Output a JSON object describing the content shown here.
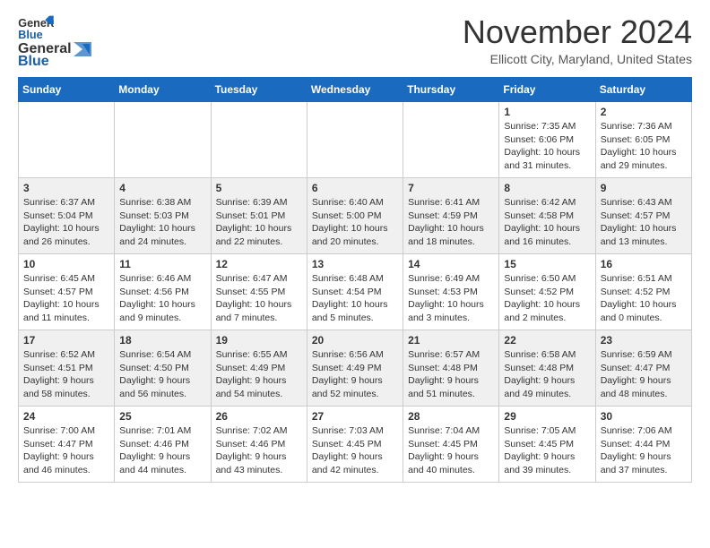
{
  "logo": {
    "general": "General",
    "blue": "Blue"
  },
  "title": "November 2024",
  "location": "Ellicott City, Maryland, United States",
  "days_of_week": [
    "Sunday",
    "Monday",
    "Tuesday",
    "Wednesday",
    "Thursday",
    "Friday",
    "Saturday"
  ],
  "weeks": [
    [
      {
        "day": "",
        "info": ""
      },
      {
        "day": "",
        "info": ""
      },
      {
        "day": "",
        "info": ""
      },
      {
        "day": "",
        "info": ""
      },
      {
        "day": "",
        "info": ""
      },
      {
        "day": "1",
        "info": "Sunrise: 7:35 AM\nSunset: 6:06 PM\nDaylight: 10 hours and 31 minutes."
      },
      {
        "day": "2",
        "info": "Sunrise: 7:36 AM\nSunset: 6:05 PM\nDaylight: 10 hours and 29 minutes."
      }
    ],
    [
      {
        "day": "3",
        "info": "Sunrise: 6:37 AM\nSunset: 5:04 PM\nDaylight: 10 hours and 26 minutes."
      },
      {
        "day": "4",
        "info": "Sunrise: 6:38 AM\nSunset: 5:03 PM\nDaylight: 10 hours and 24 minutes."
      },
      {
        "day": "5",
        "info": "Sunrise: 6:39 AM\nSunset: 5:01 PM\nDaylight: 10 hours and 22 minutes."
      },
      {
        "day": "6",
        "info": "Sunrise: 6:40 AM\nSunset: 5:00 PM\nDaylight: 10 hours and 20 minutes."
      },
      {
        "day": "7",
        "info": "Sunrise: 6:41 AM\nSunset: 4:59 PM\nDaylight: 10 hours and 18 minutes."
      },
      {
        "day": "8",
        "info": "Sunrise: 6:42 AM\nSunset: 4:58 PM\nDaylight: 10 hours and 16 minutes."
      },
      {
        "day": "9",
        "info": "Sunrise: 6:43 AM\nSunset: 4:57 PM\nDaylight: 10 hours and 13 minutes."
      }
    ],
    [
      {
        "day": "10",
        "info": "Sunrise: 6:45 AM\nSunset: 4:57 PM\nDaylight: 10 hours and 11 minutes."
      },
      {
        "day": "11",
        "info": "Sunrise: 6:46 AM\nSunset: 4:56 PM\nDaylight: 10 hours and 9 minutes."
      },
      {
        "day": "12",
        "info": "Sunrise: 6:47 AM\nSunset: 4:55 PM\nDaylight: 10 hours and 7 minutes."
      },
      {
        "day": "13",
        "info": "Sunrise: 6:48 AM\nSunset: 4:54 PM\nDaylight: 10 hours and 5 minutes."
      },
      {
        "day": "14",
        "info": "Sunrise: 6:49 AM\nSunset: 4:53 PM\nDaylight: 10 hours and 3 minutes."
      },
      {
        "day": "15",
        "info": "Sunrise: 6:50 AM\nSunset: 4:52 PM\nDaylight: 10 hours and 2 minutes."
      },
      {
        "day": "16",
        "info": "Sunrise: 6:51 AM\nSunset: 4:52 PM\nDaylight: 10 hours and 0 minutes."
      }
    ],
    [
      {
        "day": "17",
        "info": "Sunrise: 6:52 AM\nSunset: 4:51 PM\nDaylight: 9 hours and 58 minutes."
      },
      {
        "day": "18",
        "info": "Sunrise: 6:54 AM\nSunset: 4:50 PM\nDaylight: 9 hours and 56 minutes."
      },
      {
        "day": "19",
        "info": "Sunrise: 6:55 AM\nSunset: 4:49 PM\nDaylight: 9 hours and 54 minutes."
      },
      {
        "day": "20",
        "info": "Sunrise: 6:56 AM\nSunset: 4:49 PM\nDaylight: 9 hours and 52 minutes."
      },
      {
        "day": "21",
        "info": "Sunrise: 6:57 AM\nSunset: 4:48 PM\nDaylight: 9 hours and 51 minutes."
      },
      {
        "day": "22",
        "info": "Sunrise: 6:58 AM\nSunset: 4:48 PM\nDaylight: 9 hours and 49 minutes."
      },
      {
        "day": "23",
        "info": "Sunrise: 6:59 AM\nSunset: 4:47 PM\nDaylight: 9 hours and 48 minutes."
      }
    ],
    [
      {
        "day": "24",
        "info": "Sunrise: 7:00 AM\nSunset: 4:47 PM\nDaylight: 9 hours and 46 minutes."
      },
      {
        "day": "25",
        "info": "Sunrise: 7:01 AM\nSunset: 4:46 PM\nDaylight: 9 hours and 44 minutes."
      },
      {
        "day": "26",
        "info": "Sunrise: 7:02 AM\nSunset: 4:46 PM\nDaylight: 9 hours and 43 minutes."
      },
      {
        "day": "27",
        "info": "Sunrise: 7:03 AM\nSunset: 4:45 PM\nDaylight: 9 hours and 42 minutes."
      },
      {
        "day": "28",
        "info": "Sunrise: 7:04 AM\nSunset: 4:45 PM\nDaylight: 9 hours and 40 minutes."
      },
      {
        "day": "29",
        "info": "Sunrise: 7:05 AM\nSunset: 4:45 PM\nDaylight: 9 hours and 39 minutes."
      },
      {
        "day": "30",
        "info": "Sunrise: 7:06 AM\nSunset: 4:44 PM\nDaylight: 9 hours and 37 minutes."
      }
    ]
  ]
}
